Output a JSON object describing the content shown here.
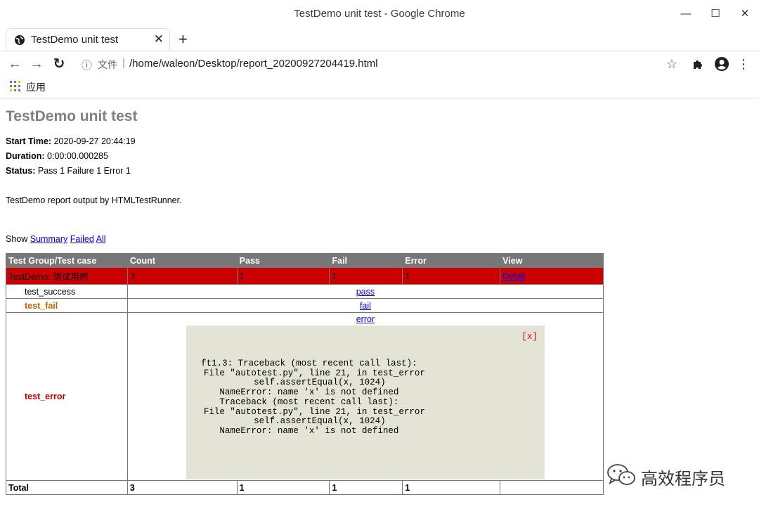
{
  "window": {
    "title": "TestDemo unit test - Google Chrome",
    "minimize_glyph": "—",
    "maximize_glyph": "☐",
    "close_glyph": "✕"
  },
  "tab": {
    "title": "TestDemo unit test",
    "close_glyph": "✕",
    "new_tab_glyph": "+"
  },
  "toolbar": {
    "back_glyph": "←",
    "forward_glyph": "→",
    "reload_glyph": "↻",
    "info_glyph": "ⓘ",
    "security_label": "文件",
    "separator": "|",
    "url": "/home/waleon/Desktop/report_20200927204419.html",
    "star_glyph": "☆",
    "menu_glyph": "⋮"
  },
  "bookmarks": {
    "apps_label": "应用"
  },
  "report": {
    "title": "TestDemo unit test",
    "start_time_label": "Start Time:",
    "start_time": "2020-09-27 20:44:19",
    "duration_label": "Duration:",
    "duration": "0:00:00.000285",
    "status_label": "Status:",
    "status": "Pass 1 Failure 1 Error 1",
    "description": "TestDemo report output by HTMLTestRunner.",
    "show_label": "Show",
    "show_links": {
      "summary": "Summary",
      "failed": "Failed",
      "all": "All"
    },
    "table": {
      "headers": [
        "Test Group/Test case",
        "Count",
        "Pass",
        "Fail",
        "Error",
        "View"
      ],
      "group": {
        "name": "TestDemo: 测试用例",
        "count": "3",
        "pass": "1",
        "fail": "1",
        "error": "1",
        "view": "Detail"
      },
      "cases": [
        {
          "name": "test_success",
          "link": "pass"
        },
        {
          "name": "test_fail",
          "link": "fail"
        },
        {
          "name": "test_error",
          "link": "error"
        }
      ],
      "popup": {
        "close": "[x]",
        "text": "ft1.3: Traceback (most recent call last):\n  File \"autotest.py\", line 21, in test_error\n    self.assertEqual(x, 1024)\nNameError: name 'x' is not defined\nTraceback (most recent call last):\n  File \"autotest.py\", line 21, in test_error\n    self.assertEqual(x, 1024)\nNameError: name 'x' is not defined"
      },
      "total": {
        "label": "Total",
        "count": "3",
        "pass": "1",
        "fail": "1",
        "error": "1"
      }
    }
  },
  "watermark": {
    "text": "高效程序员"
  },
  "colors": {
    "header_bg": "#777777",
    "error_class_bg": "#cc0000",
    "popup_bg": "#e3e3d6",
    "fail_case": "#c46400",
    "error_case": "#c00000",
    "link": "#0000ee"
  }
}
